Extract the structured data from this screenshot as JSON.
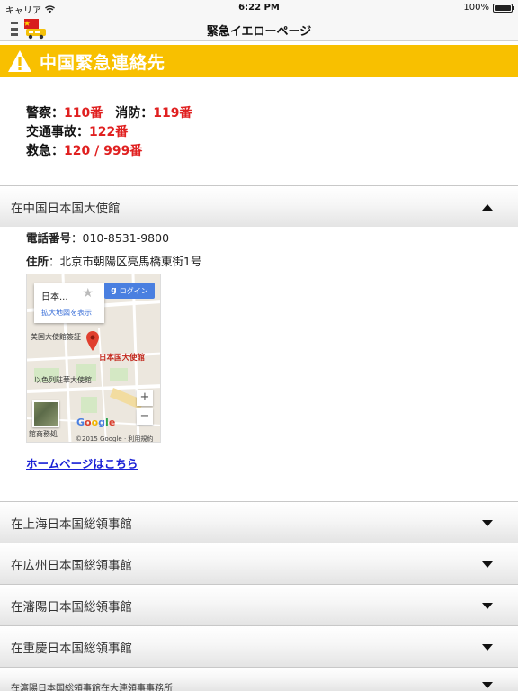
{
  "status_bar": {
    "carrier": "キャリア",
    "time": "6:22 PM",
    "battery_text": "100%",
    "battery_level": 1.0
  },
  "nav": {
    "title": "緊急イエローページ"
  },
  "banner": {
    "title": "中国緊急連絡先",
    "color": "#f8c000"
  },
  "emergency": {
    "police_label": "警察：",
    "police_number": "110番",
    "fire_label": "消防：",
    "fire_number": "119番",
    "traffic_label": "交通事故：",
    "traffic_number": "122番",
    "ambulance_label": "救急：",
    "ambulance_number": "120 / 999番",
    "number_color": "#e02020"
  },
  "sections": [
    {
      "title": "在中国日本国大使館",
      "expanded": true,
      "phone_label": "電話番号",
      "phone_value": "：010-8531-9800",
      "address_label": "住所",
      "address_value": "：北京市朝陽区亮馬橋東街1号",
      "homepage_link": "ホームページはこちら",
      "map": {
        "card_name": "日本...",
        "card_link": "拡大地図を表示",
        "login": "ログイン",
        "label_us_embassy": "美国大使館簽証",
        "label_jp_embassy": "日本国大使館",
        "label_israel": "以色列駐華大使館",
        "label_bottom": "館商務処",
        "google": "Google",
        "copyright": "©2015 Google ·  利用規約",
        "zoom_in": "+",
        "zoom_out": "−"
      }
    },
    {
      "title": "在上海日本国総領事館",
      "expanded": false
    },
    {
      "title": "在広州日本国総領事館",
      "expanded": false
    },
    {
      "title": "在瀋陽日本国総領事館",
      "expanded": false
    },
    {
      "title": "在重慶日本国総領事館",
      "expanded": false
    },
    {
      "title": "在瀋陽日本国総領事館在大連領事事務所",
      "expanded": false
    }
  ]
}
